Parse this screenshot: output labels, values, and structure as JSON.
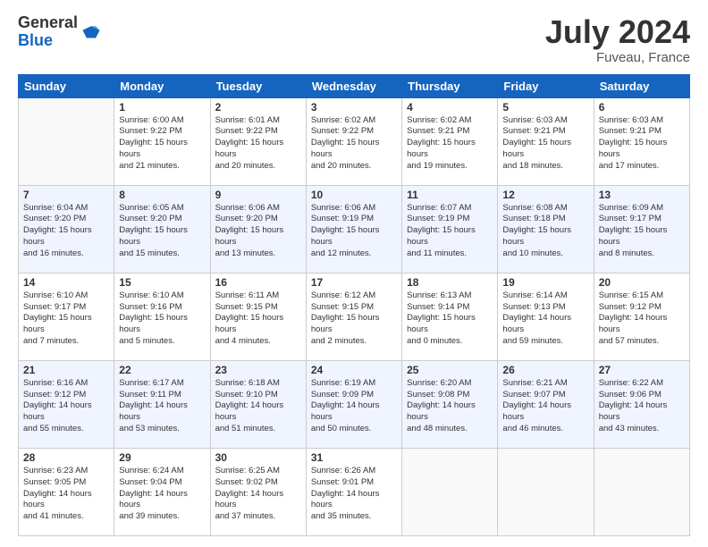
{
  "logo": {
    "general": "General",
    "blue": "Blue"
  },
  "title": {
    "month_year": "July 2024",
    "location": "Fuveau, France"
  },
  "headers": [
    "Sunday",
    "Monday",
    "Tuesday",
    "Wednesday",
    "Thursday",
    "Friday",
    "Saturday"
  ],
  "weeks": [
    [
      {
        "day": "",
        "sunrise": "",
        "sunset": "",
        "daylight": ""
      },
      {
        "day": "1",
        "sunrise": "Sunrise: 6:00 AM",
        "sunset": "Sunset: 9:22 PM",
        "daylight": "Daylight: 15 hours and 21 minutes."
      },
      {
        "day": "2",
        "sunrise": "Sunrise: 6:01 AM",
        "sunset": "Sunset: 9:22 PM",
        "daylight": "Daylight: 15 hours and 20 minutes."
      },
      {
        "day": "3",
        "sunrise": "Sunrise: 6:02 AM",
        "sunset": "Sunset: 9:22 PM",
        "daylight": "Daylight: 15 hours and 20 minutes."
      },
      {
        "day": "4",
        "sunrise": "Sunrise: 6:02 AM",
        "sunset": "Sunset: 9:21 PM",
        "daylight": "Daylight: 15 hours and 19 minutes."
      },
      {
        "day": "5",
        "sunrise": "Sunrise: 6:03 AM",
        "sunset": "Sunset: 9:21 PM",
        "daylight": "Daylight: 15 hours and 18 minutes."
      },
      {
        "day": "6",
        "sunrise": "Sunrise: 6:03 AM",
        "sunset": "Sunset: 9:21 PM",
        "daylight": "Daylight: 15 hours and 17 minutes."
      }
    ],
    [
      {
        "day": "7",
        "sunrise": "Sunrise: 6:04 AM",
        "sunset": "Sunset: 9:20 PM",
        "daylight": "Daylight: 15 hours and 16 minutes."
      },
      {
        "day": "8",
        "sunrise": "Sunrise: 6:05 AM",
        "sunset": "Sunset: 9:20 PM",
        "daylight": "Daylight: 15 hours and 15 minutes."
      },
      {
        "day": "9",
        "sunrise": "Sunrise: 6:06 AM",
        "sunset": "Sunset: 9:20 PM",
        "daylight": "Daylight: 15 hours and 13 minutes."
      },
      {
        "day": "10",
        "sunrise": "Sunrise: 6:06 AM",
        "sunset": "Sunset: 9:19 PM",
        "daylight": "Daylight: 15 hours and 12 minutes."
      },
      {
        "day": "11",
        "sunrise": "Sunrise: 6:07 AM",
        "sunset": "Sunset: 9:19 PM",
        "daylight": "Daylight: 15 hours and 11 minutes."
      },
      {
        "day": "12",
        "sunrise": "Sunrise: 6:08 AM",
        "sunset": "Sunset: 9:18 PM",
        "daylight": "Daylight: 15 hours and 10 minutes."
      },
      {
        "day": "13",
        "sunrise": "Sunrise: 6:09 AM",
        "sunset": "Sunset: 9:17 PM",
        "daylight": "Daylight: 15 hours and 8 minutes."
      }
    ],
    [
      {
        "day": "14",
        "sunrise": "Sunrise: 6:10 AM",
        "sunset": "Sunset: 9:17 PM",
        "daylight": "Daylight: 15 hours and 7 minutes."
      },
      {
        "day": "15",
        "sunrise": "Sunrise: 6:10 AM",
        "sunset": "Sunset: 9:16 PM",
        "daylight": "Daylight: 15 hours and 5 minutes."
      },
      {
        "day": "16",
        "sunrise": "Sunrise: 6:11 AM",
        "sunset": "Sunset: 9:15 PM",
        "daylight": "Daylight: 15 hours and 4 minutes."
      },
      {
        "day": "17",
        "sunrise": "Sunrise: 6:12 AM",
        "sunset": "Sunset: 9:15 PM",
        "daylight": "Daylight: 15 hours and 2 minutes."
      },
      {
        "day": "18",
        "sunrise": "Sunrise: 6:13 AM",
        "sunset": "Sunset: 9:14 PM",
        "daylight": "Daylight: 15 hours and 0 minutes."
      },
      {
        "day": "19",
        "sunrise": "Sunrise: 6:14 AM",
        "sunset": "Sunset: 9:13 PM",
        "daylight": "Daylight: 14 hours and 59 minutes."
      },
      {
        "day": "20",
        "sunrise": "Sunrise: 6:15 AM",
        "sunset": "Sunset: 9:12 PM",
        "daylight": "Daylight: 14 hours and 57 minutes."
      }
    ],
    [
      {
        "day": "21",
        "sunrise": "Sunrise: 6:16 AM",
        "sunset": "Sunset: 9:12 PM",
        "daylight": "Daylight: 14 hours and 55 minutes."
      },
      {
        "day": "22",
        "sunrise": "Sunrise: 6:17 AM",
        "sunset": "Sunset: 9:11 PM",
        "daylight": "Daylight: 14 hours and 53 minutes."
      },
      {
        "day": "23",
        "sunrise": "Sunrise: 6:18 AM",
        "sunset": "Sunset: 9:10 PM",
        "daylight": "Daylight: 14 hours and 51 minutes."
      },
      {
        "day": "24",
        "sunrise": "Sunrise: 6:19 AM",
        "sunset": "Sunset: 9:09 PM",
        "daylight": "Daylight: 14 hours and 50 minutes."
      },
      {
        "day": "25",
        "sunrise": "Sunrise: 6:20 AM",
        "sunset": "Sunset: 9:08 PM",
        "daylight": "Daylight: 14 hours and 48 minutes."
      },
      {
        "day": "26",
        "sunrise": "Sunrise: 6:21 AM",
        "sunset": "Sunset: 9:07 PM",
        "daylight": "Daylight: 14 hours and 46 minutes."
      },
      {
        "day": "27",
        "sunrise": "Sunrise: 6:22 AM",
        "sunset": "Sunset: 9:06 PM",
        "daylight": "Daylight: 14 hours and 43 minutes."
      }
    ],
    [
      {
        "day": "28",
        "sunrise": "Sunrise: 6:23 AM",
        "sunset": "Sunset: 9:05 PM",
        "daylight": "Daylight: 14 hours and 41 minutes."
      },
      {
        "day": "29",
        "sunrise": "Sunrise: 6:24 AM",
        "sunset": "Sunset: 9:04 PM",
        "daylight": "Daylight: 14 hours and 39 minutes."
      },
      {
        "day": "30",
        "sunrise": "Sunrise: 6:25 AM",
        "sunset": "Sunset: 9:02 PM",
        "daylight": "Daylight: 14 hours and 37 minutes."
      },
      {
        "day": "31",
        "sunrise": "Sunrise: 6:26 AM",
        "sunset": "Sunset: 9:01 PM",
        "daylight": "Daylight: 14 hours and 35 minutes."
      },
      {
        "day": "",
        "sunrise": "",
        "sunset": "",
        "daylight": ""
      },
      {
        "day": "",
        "sunrise": "",
        "sunset": "",
        "daylight": ""
      },
      {
        "day": "",
        "sunrise": "",
        "sunset": "",
        "daylight": ""
      }
    ]
  ]
}
